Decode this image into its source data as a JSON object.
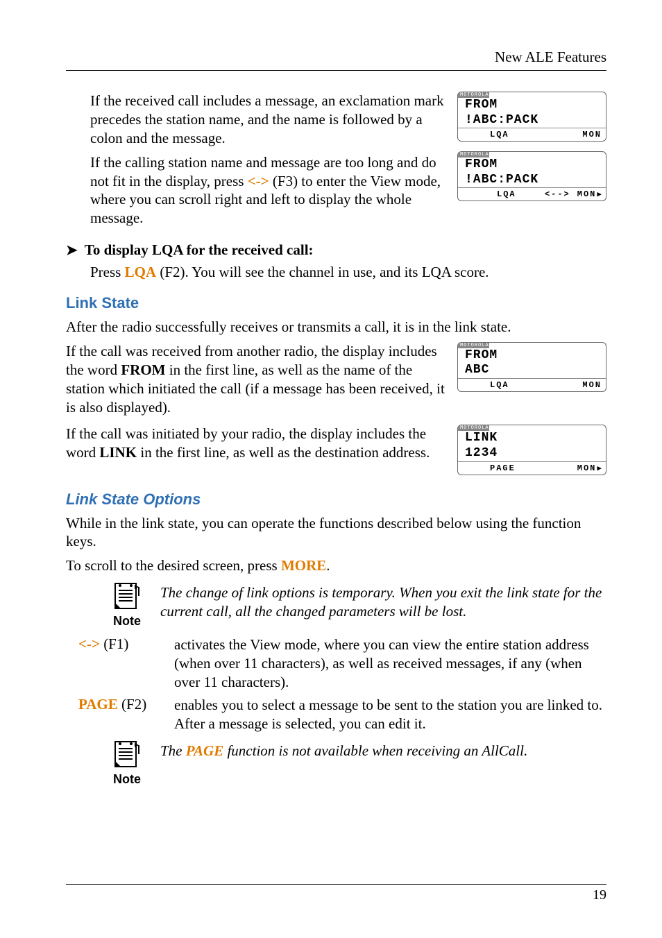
{
  "header": {
    "section": "New ALE Features"
  },
  "para_msg_call": "If the received call includes a message, an exclamation mark precedes the station name, and the name is followed by a colon and the message.",
  "para_too_long_a": "If the calling station name and message are too long and do not fit in the display, press ",
  "key_view": "<->",
  "para_too_long_b": " (F3) to enter the View mode, where you can scroll right and left to display the whole message.",
  "lcd1": {
    "brand": "MOTOROLA",
    "l1": "FROM",
    "l2": "!ABC:PACK",
    "f1": "LQA",
    "f2": "",
    "f3": "MON"
  },
  "lcd2": {
    "brand": "MOTOROLA",
    "l1": "FROM",
    "l2": "!ABC:PACK",
    "f1": "",
    "f2": "LQA",
    "f3": "<-->",
    "f4": "MON",
    "arrow": "▶"
  },
  "proc": {
    "title": "To display LQA for the received call:",
    "press": "Press ",
    "key": "LQA",
    "rest": " (F2). You will see the channel in use, and its LQA score."
  },
  "h_link_state": "Link State",
  "para_link_intro": "After the radio successfully receives or transmits a call, it is in the link state.",
  "para_from_a": "If the call was received from another radio, the display includes the word ",
  "w_from": "FROM",
  "para_from_b": " in the first line, as well as the name of the station which initiated the call (if a message has been received, it is also displayed).",
  "para_link_a": "If the call was initiated by your radio, the display includes the word ",
  "w_link": "LINK",
  "para_link_b": " in the first line, as well as the destination address.",
  "lcd3": {
    "brand": "MOTOROLA",
    "l1": "FROM",
    "l2": "ABC",
    "f1": "LQA",
    "f2": "",
    "f3": "MON"
  },
  "lcd4": {
    "brand": "MOTOROLA",
    "l1": "LINK",
    "l2": "1234",
    "f1": "",
    "f2": "PAGE",
    "f3": "MON",
    "arrow": "▶"
  },
  "h_link_opts": "Link State Options",
  "para_opts_intro": "While in the link state, you can operate the functions described below using the function keys.",
  "para_scroll_a": "To scroll to the desired screen, press ",
  "key_more": "MORE",
  "period": ".",
  "note1": "The change of link options is temporary. When you exit the link state for the current call, all the changed parameters will be lost.",
  "note_label": "Note",
  "opt1": {
    "key": "<->",
    "suffix": " (F1)",
    "body": "activates the View mode, where you can view the entire station address (when over 11 characters), as well as received messages, if any (when over 11 characters)."
  },
  "opt2": {
    "key": "PAGE",
    "suffix": " (F2)",
    "body": "enables you to select a message to be sent to the station you are linked to. After a message is selected, you can edit it."
  },
  "note2_a": "The ",
  "note2_key": "PAGE",
  "note2_b": " function is not available when receiving an AllCall.",
  "page_number": "19"
}
